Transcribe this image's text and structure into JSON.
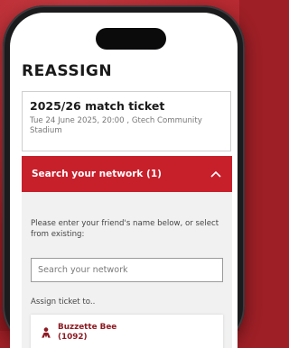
{
  "page": {
    "title": "REASSIGN"
  },
  "ticket": {
    "title": "2025/26 match ticket",
    "details": "Tue 24 June 2025, 20:00 , Gtech Community Stadium"
  },
  "network": {
    "header_label": "Search your network (1)",
    "expanded_icon": "chevron-up-icon",
    "instructions": "Please enter your friend's name below, or select from existing:",
    "search_placeholder": "Search your network",
    "assign_label": "Assign ticket to..",
    "friends": [
      {
        "name": "Buzzette Bee",
        "id": "(1092)",
        "icon": "person-icon"
      }
    ]
  },
  "colors": {
    "brand_red": "#c8202b",
    "name_red": "#8e1a22",
    "background": "#9e1f26"
  }
}
